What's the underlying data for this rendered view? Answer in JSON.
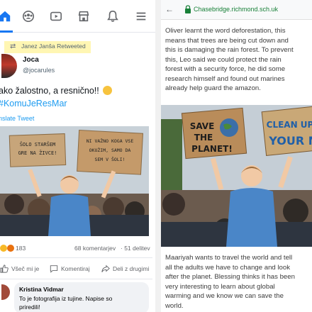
{
  "left": {
    "nav": {
      "icons": [
        "home-icon",
        "groups-icon",
        "video-icon",
        "marketplace-icon",
        "notifications-icon",
        "menu-icon"
      ],
      "accent": "#1877f2"
    },
    "post": {
      "retweet_label": "Janez Janša Retweeted",
      "author_name": "Joca",
      "author_handle": "@jocarules",
      "text": "ako žalostno, a resnično!!",
      "hashtag": "KomuJeResMar",
      "translate": "nslate Tweet",
      "sign_left": "ŠOLO STARŠEM GRE NA ŽIVCE!",
      "sign_right": "NI VAŽNO KOGA VSE OKUŽIM, SAMO DA SEM V ŠOLI!"
    },
    "stats": {
      "reactions": "183",
      "comments": "68 komentarjev",
      "shares": "51 delitev"
    },
    "actions": {
      "like": "Všeč mi je",
      "comment": "Komentiraj",
      "share": "Deli z drugimi"
    },
    "comment": {
      "name": "Kristina Vidmar",
      "line1": "To je fotografija iz tujine. Napise so",
      "line2": "prirediliǃ"
    }
  },
  "right": {
    "url": "Chasebridge.richmond.sch.uk",
    "para1": [
      "Oliver learnt the word deforestation, this",
      "means that trees are being cut down and",
      "this is damaging the rain forest. To prevent",
      "this, Leo said we could protect the rain",
      "forest with a security force, he did some",
      "research himself and found out marines",
      "already help guard the amazon."
    ],
    "sign_left": "SAVE THE PLANET!",
    "sign_right": "CLEAN UP YOUR M",
    "para2": [
      "Maariyah wants to travel the world and tell",
      "all the adults we have to change and look",
      "after the planet. Blessing thinks it has been",
      "very interesting to learn about global",
      "warming and we know we can save the",
      "world."
    ]
  }
}
